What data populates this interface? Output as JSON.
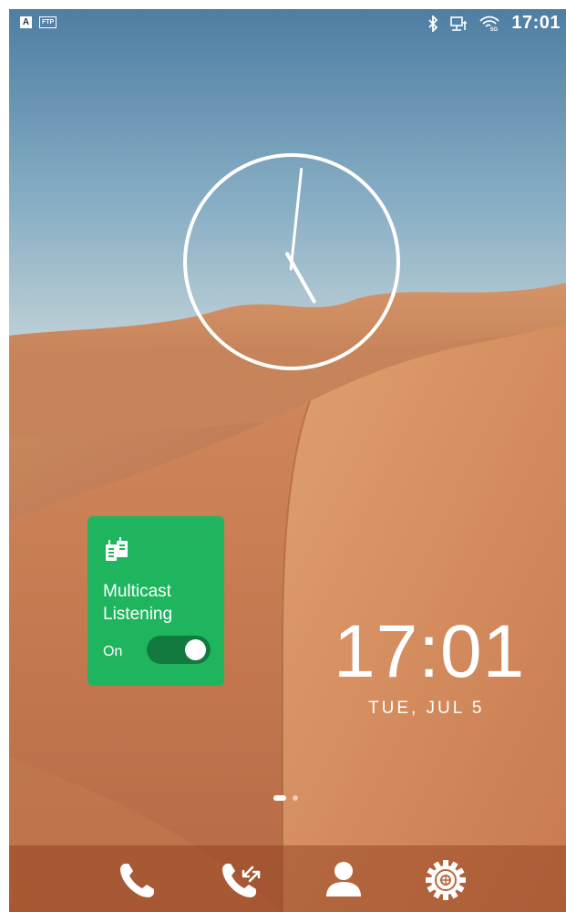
{
  "status_bar": {
    "indicator_a": "A",
    "indicator_ftp": "FTP",
    "time": "17:01",
    "icons": [
      "bluetooth-icon",
      "network-monitor-icon",
      "wifi-5g-icon"
    ],
    "wifi_band": "5G"
  },
  "analog_clock": {
    "hour": 17,
    "minute": 1
  },
  "widget": {
    "title": "Multicast Listening",
    "state_label": "On",
    "toggle_on": true,
    "icon": "walkie-talkie-icon",
    "color": "#1fb55e"
  },
  "digital_clock": {
    "time": "17:01",
    "date": "TUE, JUL 5"
  },
  "pager": {
    "pages": 2,
    "active": 0
  },
  "dock": {
    "items": [
      {
        "name": "phone",
        "icon": "phone-icon"
      },
      {
        "name": "call-history",
        "icon": "call-history-icon"
      },
      {
        "name": "contacts",
        "icon": "contacts-icon"
      },
      {
        "name": "settings",
        "icon": "settings-gear-icon"
      }
    ]
  }
}
